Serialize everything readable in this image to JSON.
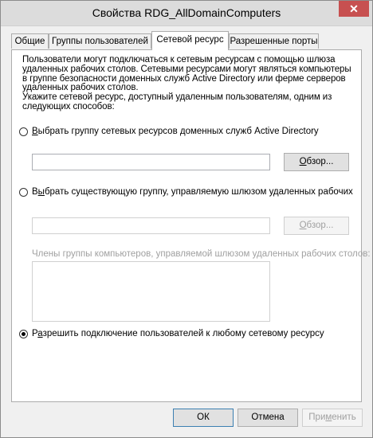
{
  "window": {
    "title": "Свойства RDG_AllDomainComputers",
    "close_glyph": "✕"
  },
  "tabs": [
    {
      "label": "Общие",
      "active": false
    },
    {
      "label": "Группы пользователей",
      "active": false
    },
    {
      "label": "Сетевой ресурс",
      "active": true
    },
    {
      "label": "Разрешенные порты",
      "active": false
    }
  ],
  "panel": {
    "intro_lines": [
      "Пользователи могут подключаться к сетевым ресурсам с помощью шлюза",
      "удаленных рабочих столов. Сетевыми ресурсами могут являться компьютеры",
      "в группе безопасности доменных служб Active Directory или ферме серверов",
      "удаленных рабочих столов.",
      "Укажите сетевой ресурс, доступный удаленным пользователям, одним из",
      "следующих способов:"
    ],
    "option_ad": {
      "prefix": "",
      "underlined": "В",
      "rest": "ыбрать группу сетевых ресурсов доменных служб Active Directory",
      "checked": false
    },
    "ad_group_value": "",
    "browse1": {
      "underlined": "О",
      "rest": "бзор..."
    },
    "option_gateway": {
      "prefix": "В",
      "underlined": "ы",
      "rest": "брать существующую группу, управляемую шлюзом удаленных рабочих",
      "checked": false
    },
    "gateway_group_value": "",
    "browse2": {
      "underlined": "О",
      "rest": "бзор..."
    },
    "members_label": "Члены группы компьютеров, управляемой шлюзом удаленных рабочих столов:",
    "option_any": {
      "prefix": "Р",
      "underlined": "а",
      "rest": "зрешить подключение пользователей к любому сетевому ресурсу",
      "checked": true
    }
  },
  "footer": {
    "ok": "ОК",
    "cancel": "Отмена",
    "apply": {
      "prefix": "При",
      "underlined": "м",
      "rest": "енить"
    }
  }
}
